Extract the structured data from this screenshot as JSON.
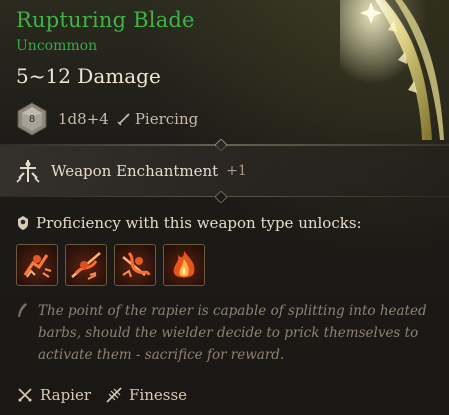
{
  "item": {
    "name": "Rupturing Blade",
    "rarity": "Uncommon",
    "damage": "5~12 Damage",
    "die_label": "8",
    "damage_formula": "1d8+4",
    "damage_type": "Piercing",
    "name_color": "#3fb346"
  },
  "enchantment": {
    "label": "Weapon Enchantment",
    "value": "+1",
    "icon": "enchant-icon"
  },
  "proficiency": {
    "label": "Proficiency with this weapon type unlocks:",
    "actions": [
      {
        "icon": "rupture-action-icon"
      },
      {
        "icon": "flourish-action-icon"
      },
      {
        "icon": "brace-action-icon"
      },
      {
        "icon": "fire-action-icon"
      }
    ]
  },
  "lore": {
    "text": "The point of the rapier is capable of splitting into heated barbs, should the wielder decide to prick themselves to activate them - sacrifice for reward."
  },
  "properties": [
    {
      "label": "Rapier",
      "icon": "rapier-icon"
    },
    {
      "label": "Finesse",
      "icon": "finesse-icon"
    }
  ]
}
